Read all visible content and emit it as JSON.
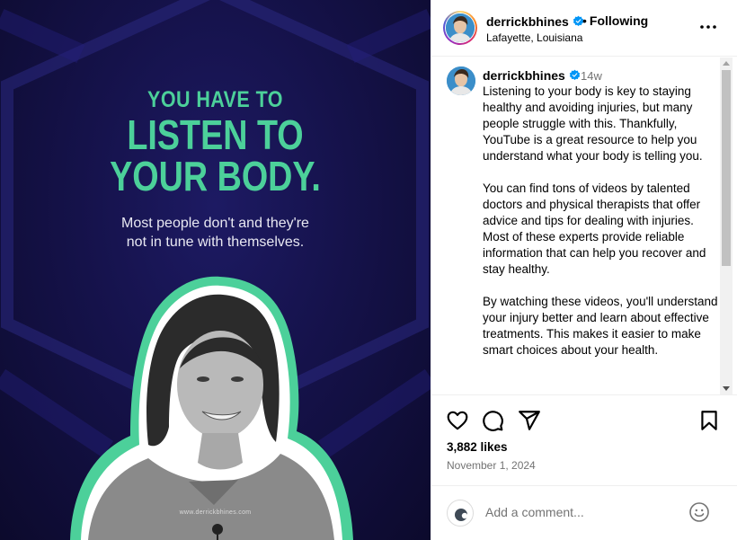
{
  "post_image": {
    "headline_small": "YOU HAVE TO",
    "headline_line2": "LISTEN TO",
    "headline_line3": "YOUR BODY.",
    "subtitle_line1": "Most people don't and they're",
    "subtitle_line2": "not in tune with themselves.",
    "watermark": "www.derrickbhines.com",
    "colors": {
      "background": "#15124a",
      "accent": "#4cd09a"
    }
  },
  "header": {
    "username": "derrickbhines",
    "separator": "•",
    "following_label": "Following",
    "location": "Lafayette, Louisiana",
    "verified_icon": "verified-badge-icon",
    "more_icon": "more-options-icon"
  },
  "caption": {
    "username": "derrickbhines",
    "time_ago": "14w",
    "paragraphs": [
      "Listening to your body is key to staying healthy and avoiding injuries, but many people struggle with this. Thankfully, YouTube is a great resource to help you understand what your body is telling you.",
      "You can find tons of videos by talented doctors and physical therapists that offer advice and tips for dealing with injuries. Most of these experts provide reliable information that can help you recover and stay healthy.",
      "By watching these videos, you'll understand your injury better and learn about effective treatments. This makes it easier to make smart choices about your health."
    ]
  },
  "actions": {
    "like_icon": "heart-icon",
    "comment_icon": "comment-icon",
    "share_icon": "share-icon",
    "save_icon": "bookmark-icon"
  },
  "stats": {
    "likes": "3,882 likes",
    "date": "November 1, 2024"
  },
  "comment": {
    "placeholder": "Add a comment...",
    "emoji_icon": "emoji-icon"
  },
  "colors": {
    "verified": "#0095f6",
    "muted_text": "#737373",
    "divider": "#efefef"
  }
}
